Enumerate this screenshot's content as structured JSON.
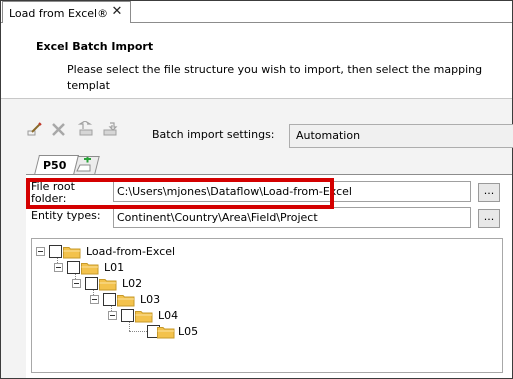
{
  "window": {
    "tab_title": "Load from Excel®",
    "close_glyph": "✕"
  },
  "header": {
    "title": "Excel Batch Import",
    "description": "Please select the file structure you wish to import, then select the mapping templat\nimport options for each."
  },
  "toolbar": {
    "icons": [
      "edit-icon",
      "delete-icon",
      "move-up-icon",
      "move-down-icon"
    ],
    "batch_label": "Batch import settings:",
    "batch_value": "Automation"
  },
  "page_tabs": {
    "active_label": "P50",
    "add_icon": "add-tab-icon"
  },
  "fields": {
    "root_label": "File root\nfolder:",
    "root_value": "C:\\Users\\mjones\\Dataflow\\Load-from-Excel",
    "entity_label": "Entity types:",
    "entity_value": "Continent\\Country\\Area\\Field\\Project",
    "browse_label": "..."
  },
  "tree": {
    "nodes": [
      {
        "label": "Load-from-Excel"
      },
      {
        "label": "L01"
      },
      {
        "label": "L02"
      },
      {
        "label": "L03"
      },
      {
        "label": "L04"
      },
      {
        "label": "L05"
      }
    ]
  },
  "colors": {
    "highlight": "#d40000",
    "folder": "#f3c24c",
    "add_icon": "#2aa33a"
  }
}
